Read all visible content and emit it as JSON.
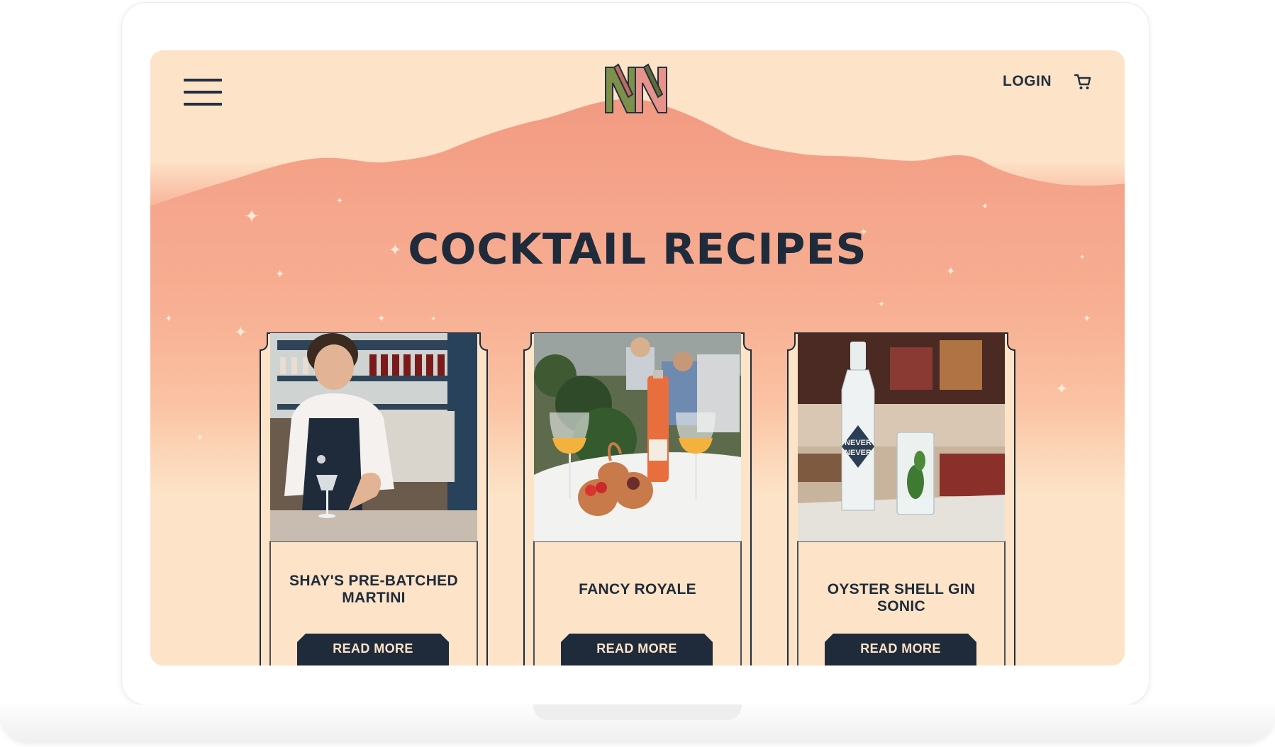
{
  "header": {
    "login_label": "LOGIN",
    "menu_icon": "hamburger-menu-icon",
    "cart_icon": "shopping-cart-icon",
    "logo_text": "NN"
  },
  "hero": {
    "title": "COCKTAIL RECIPES"
  },
  "cards": [
    {
      "title": "SHAY'S PRE-BATCHED MARTINI",
      "button_label": "READ MORE"
    },
    {
      "title": "FANCY ROYALE",
      "button_label": "READ MORE"
    },
    {
      "title": "OYSTER SHELL GIN SONIC",
      "button_label": "READ MORE"
    }
  ],
  "photo_labels": {
    "bottle_brand_line1": "NEVER",
    "bottle_brand_line2": "NEVER"
  },
  "colors": {
    "navy": "#1f2b3b",
    "cream": "#fde3c7",
    "salmon": "#f6a38b",
    "logo_green": "#7d8f4a",
    "logo_pink": "#e7938b"
  }
}
